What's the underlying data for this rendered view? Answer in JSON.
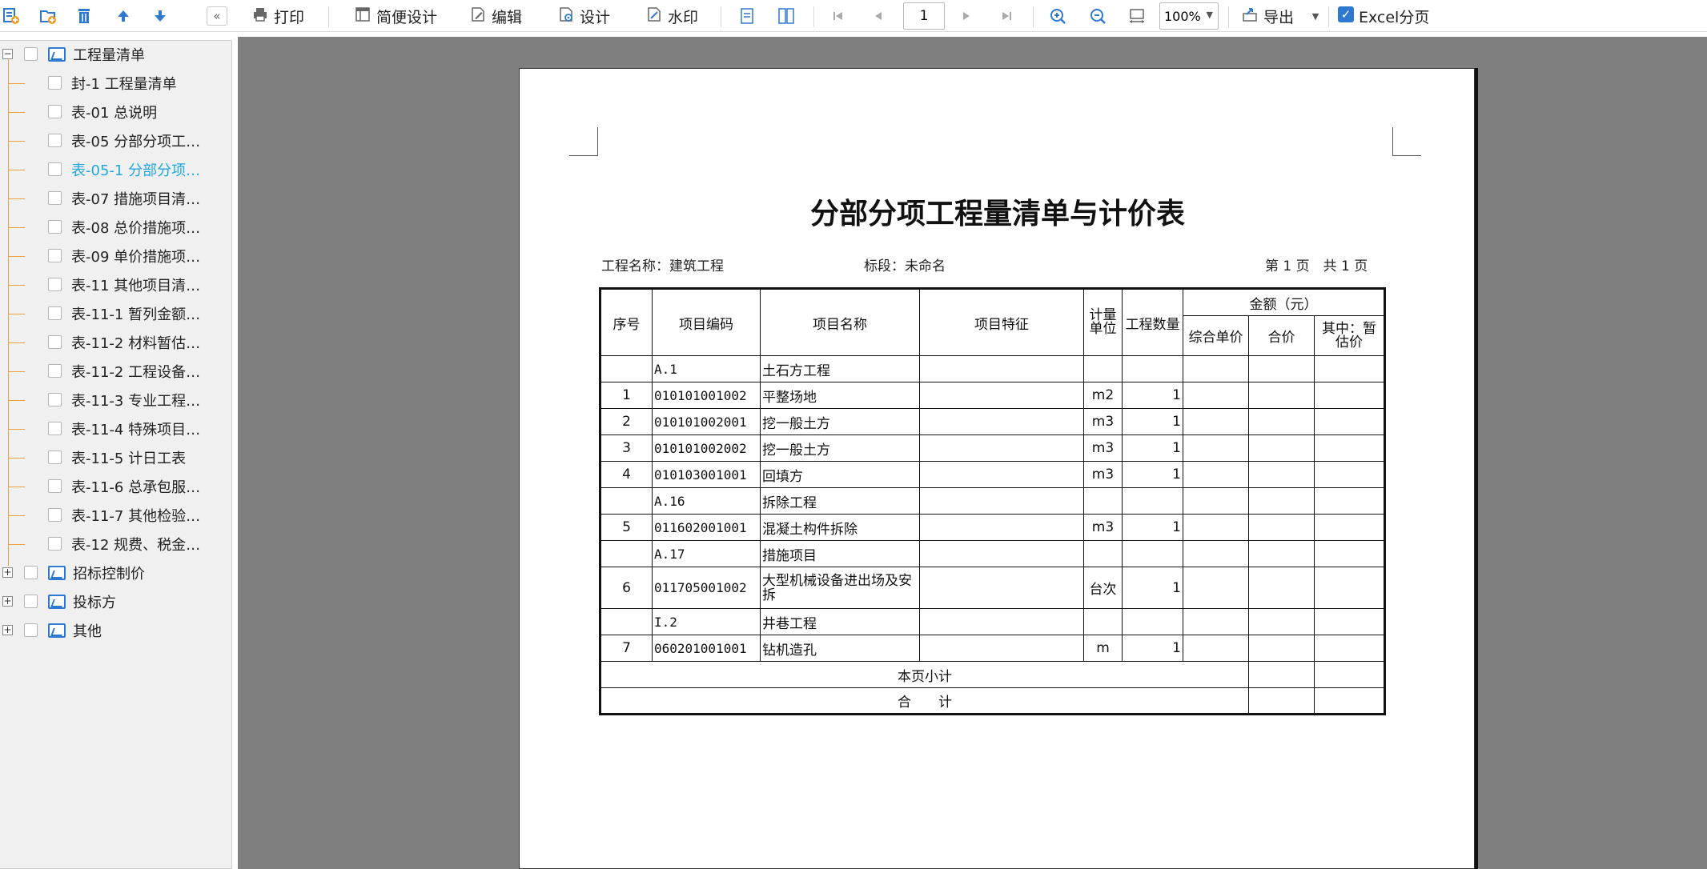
{
  "toolbar": {
    "icons": [
      "add-report-icon",
      "add-folder-icon",
      "delete-icon",
      "move-up-icon",
      "move-down-icon"
    ],
    "collapse_label": "«",
    "print": "打印",
    "simple_design": "简便设计",
    "edit": "编辑",
    "design": "设计",
    "watermark": "水印",
    "page_value": "1",
    "zoom_value": "100%",
    "export": "导出",
    "excel_paging": "Excel分页",
    "excel_paging_checked": true
  },
  "sidebar": {
    "root_label": "工程量清单",
    "items": [
      {
        "label": "封-1 工程量清单",
        "active": false
      },
      {
        "label": "表-01 总说明",
        "active": false
      },
      {
        "label": "表-05 分部分项工…",
        "active": false
      },
      {
        "label": "表-05-1 分部分项…",
        "active": true
      },
      {
        "label": "表-07 措施项目清…",
        "active": false
      },
      {
        "label": "表-08 总价措施项…",
        "active": false
      },
      {
        "label": "表-09 单价措施项…",
        "active": false
      },
      {
        "label": "表-11 其他项目清…",
        "active": false
      },
      {
        "label": "表-11-1 暂列金额…",
        "active": false
      },
      {
        "label": "表-11-2 材料暂估…",
        "active": false
      },
      {
        "label": "表-11-2 工程设备…",
        "active": false
      },
      {
        "label": "表-11-3 专业工程…",
        "active": false
      },
      {
        "label": "表-11-4 特殊项目…",
        "active": false
      },
      {
        "label": "表-11-5 计日工表",
        "active": false
      },
      {
        "label": "表-11-6 总承包服…",
        "active": false
      },
      {
        "label": "表-11-7 其他检验…",
        "active": false
      },
      {
        "label": "表-12 规费、税金…",
        "active": false
      }
    ],
    "groups": [
      "招标控制价",
      "投标方",
      "其他"
    ]
  },
  "document": {
    "title": "分部分项工程量清单与计价表",
    "project_label": "工程名称：建筑工程",
    "section_label": "标段：未命名",
    "page_label": "第 1 页　共 1 页",
    "headers": {
      "seq": "序号",
      "code": "项目编码",
      "name": "项目名称",
      "feature": "项目特征",
      "unit_l1": "计量",
      "unit_l2": "单位",
      "qty": "工程数量",
      "amount": "金额（元）",
      "unit_price": "综合单价",
      "total": "合价",
      "prov_l1": "其中：暂",
      "prov_l2": "估价"
    },
    "rows": [
      {
        "seq": "",
        "code": "A.1",
        "name": "土石方工程",
        "unit": "",
        "qty": ""
      },
      {
        "seq": "1",
        "code": "010101001002",
        "name": "平整场地",
        "unit": "m2",
        "qty": "1"
      },
      {
        "seq": "2",
        "code": "010101002001",
        "name": "挖一般土方",
        "unit": "m3",
        "qty": "1"
      },
      {
        "seq": "3",
        "code": "010101002002",
        "name": "挖一般土方",
        "unit": "m3",
        "qty": "1"
      },
      {
        "seq": "4",
        "code": "010103001001",
        "name": "回填方",
        "unit": "m3",
        "qty": "1"
      },
      {
        "seq": "",
        "code": "A.16",
        "name": "拆除工程",
        "unit": "",
        "qty": ""
      },
      {
        "seq": "5",
        "code": "011602001001",
        "name": "混凝土构件拆除",
        "unit": "m3",
        "qty": "1"
      },
      {
        "seq": "",
        "code": "A.17",
        "name": "措施项目",
        "unit": "",
        "qty": ""
      },
      {
        "seq": "6",
        "code": "011705001002",
        "name": "大型机械设备进出场及安拆",
        "unit": "台次",
        "qty": "1"
      },
      {
        "seq": "",
        "code": "I.2",
        "name": "井巷工程",
        "unit": "",
        "qty": ""
      },
      {
        "seq": "7",
        "code": "060201001001",
        "name": "钻机造孔",
        "unit": "m",
        "qty": "1"
      }
    ],
    "subtotal_label": "本页小计",
    "total_label": "合　　计"
  }
}
